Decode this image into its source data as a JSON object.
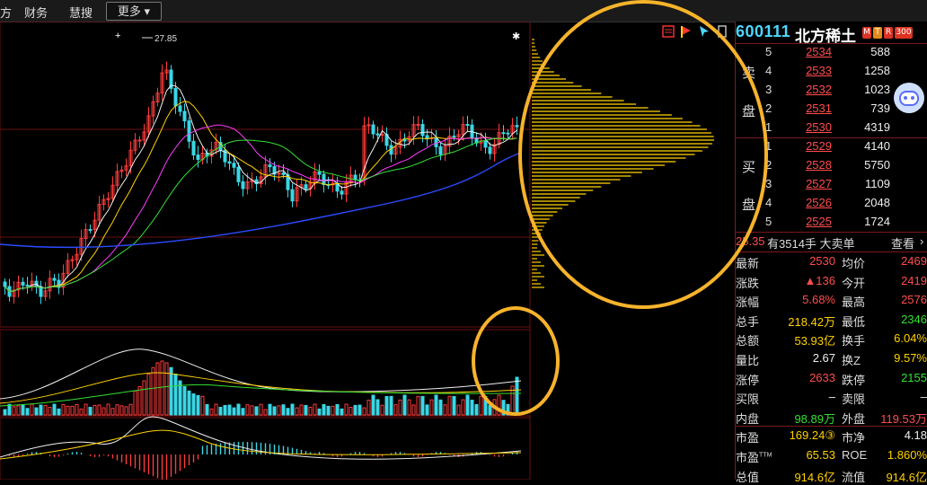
{
  "menu": {
    "partial": "方",
    "items": [
      "财务",
      "慧搜"
    ],
    "more": "更多"
  },
  "stock": {
    "code": "600111",
    "name": "北方稀土",
    "tags": [
      "M",
      "T",
      "R",
      "300"
    ]
  },
  "sell_side_label": [
    "卖",
    "盘"
  ],
  "buy_side_label": [
    "买",
    "盘"
  ],
  "sell_book": [
    {
      "level": "5",
      "price": "2534",
      "volume": "588"
    },
    {
      "level": "4",
      "price": "2533",
      "volume": "1258"
    },
    {
      "level": "3",
      "price": "2532",
      "volume": "1023"
    },
    {
      "level": "2",
      "price": "2531",
      "volume": "739"
    },
    {
      "level": "1",
      "price": "2530",
      "volume": "4319"
    }
  ],
  "buy_book": [
    {
      "level": "1",
      "price": "2529",
      "volume": "4140"
    },
    {
      "level": "2",
      "price": "2528",
      "volume": "5750"
    },
    {
      "level": "3",
      "price": "2527",
      "volume": "1109"
    },
    {
      "level": "4",
      "price": "2526",
      "volume": "2048"
    },
    {
      "level": "5",
      "price": "2525",
      "volume": "1724"
    }
  ],
  "big_order": {
    "price": "25.35",
    "text": "有3514手 大卖单",
    "link": "查看"
  },
  "stats": [
    {
      "l1": "最新",
      "v1": "2530",
      "c1": "red",
      "l2": "均价",
      "v2": "2469",
      "c2": "red"
    },
    {
      "l1": "涨跌",
      "v1": "▲136",
      "c1": "red",
      "l2": "今开",
      "v2": "2419",
      "c2": "red"
    },
    {
      "l1": "涨幅",
      "v1": "5.68%",
      "c1": "red",
      "l2": "最高",
      "v2": "2576",
      "c2": "red"
    },
    {
      "l1": "总手",
      "v1": "218.42万",
      "c1": "yellow",
      "l2": "最低",
      "v2": "2346",
      "c2": "green"
    },
    {
      "l1": "总额",
      "v1": "53.93亿",
      "c1": "yellow",
      "l2": "换手",
      "v2": "6.04%",
      "c2": "yellow"
    },
    {
      "l1": "量比",
      "v1": "2.67",
      "c1": "white",
      "l2": "换Z",
      "v2": "9.57%",
      "c2": "yellow"
    },
    {
      "l1": "涨停",
      "v1": "2633",
      "c1": "red",
      "l2": "跌停",
      "v2": "2155",
      "c2": "green"
    },
    {
      "l1": "买限",
      "v1": "–",
      "c1": "white",
      "l2": "卖限",
      "v2": "–",
      "c2": "white"
    },
    {
      "l1": "内盘",
      "v1": "98.89万",
      "c1": "green",
      "l2": "外盘",
      "v2": "119.53万",
      "c2": "red"
    },
    {
      "l1": "市盈",
      "v1": "169.24③",
      "c1": "yellow",
      "l2": "市净",
      "v2": "4.18",
      "c2": "white"
    },
    {
      "l1": "市盈TTM",
      "v1": "65.53",
      "c1": "yellow",
      "l2": "ROE",
      "v2": "1.860%",
      "c2": "yellow"
    },
    {
      "l1": "总值",
      "v1": "914.6亿",
      "c1": "yellow",
      "l2": "流值",
      "v2": "914.6亿",
      "c2": "yellow"
    }
  ],
  "chart": {
    "high_label": "27.85"
  },
  "colors": {
    "up": "#ff3b3b",
    "down": "#39d7e6",
    "ma_white": "#f0f0f0",
    "ma_yellow": "#ffd200",
    "ma_magenta": "#ff3cff",
    "ma_green": "#33e033",
    "ma_blue": "#2b4bff",
    "grid": "#6a1010",
    "highlight": "#f7b32b"
  }
}
